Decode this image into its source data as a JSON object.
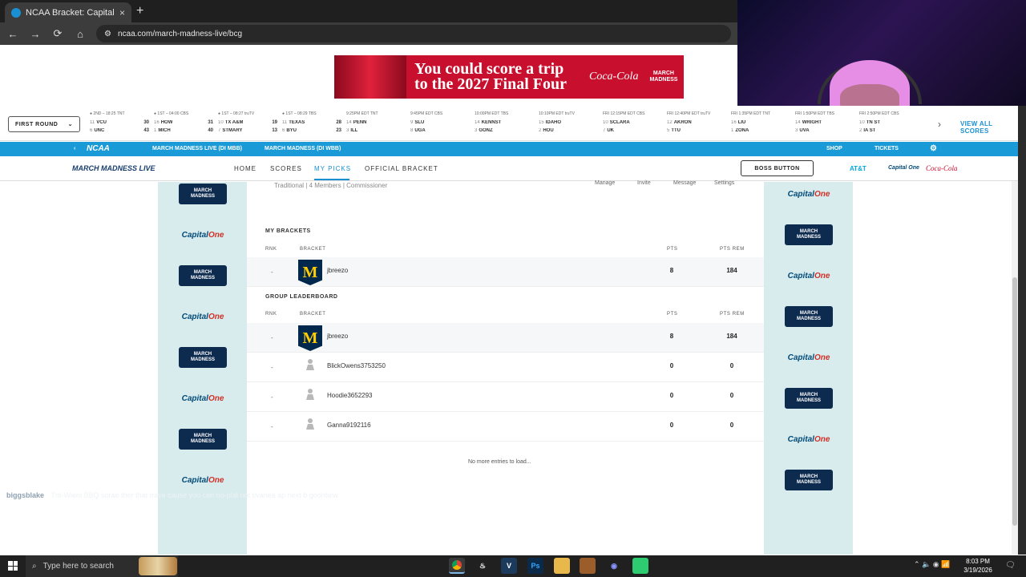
{
  "browser": {
    "tab_title": "NCAA Bracket: Capital One March Madness",
    "new_tab": "+",
    "close": "×",
    "url": "ncaa.com/march-madness-live/bcg",
    "back": "←",
    "forward": "→",
    "reload": "⟳",
    "home": "⌂",
    "site_info": "⚙"
  },
  "ad": {
    "headline_1": "You could score a trip",
    "headline_2": "to the 2027 Final Four",
    "brand": "Coca-Cola",
    "partner_1": "MARCH",
    "partner_2": "MADNESS"
  },
  "ticker": {
    "round_label": "FIRST ROUND",
    "round_chevron": "⌄",
    "games": [
      {
        "status": "● 2ND – 18:25   TNT",
        "t1_seed": "11",
        "t1": "VCU",
        "t1_score": "30",
        "t2_seed": "6",
        "t2": "UNC",
        "t2_score": "43"
      },
      {
        "status": "● 1ST – 04:00   CBS",
        "t1_seed": "16",
        "t1": "HOW",
        "t1_score": "31",
        "t2_seed": "1",
        "t2": "MICH",
        "t2_score": "40"
      },
      {
        "status": "● 1ST – 08:27   truTV",
        "t1_seed": "10",
        "t1": "TX A&M",
        "t1_score": "19",
        "t2_seed": "7",
        "t2": "STMARY",
        "t2_score": "13"
      },
      {
        "status": "● 1ST – 08:29   TBS",
        "t1_seed": "11",
        "t1": "TEXAS",
        "t1_score": "28",
        "t2_seed": "6",
        "t2": "BYU",
        "t2_score": "23"
      },
      {
        "status": "9:25PM EDT   TNT",
        "t1_seed": "14",
        "t1": "PENN",
        "t1_score": "",
        "t2_seed": "3",
        "t2": "ILL",
        "t2_score": ""
      },
      {
        "status": "9:45PM EDT   CBS",
        "t1_seed": "9",
        "t1": "SLU",
        "t1_score": "",
        "t2_seed": "8",
        "t2": "UGA",
        "t2_score": ""
      },
      {
        "status": "10:00PM EDT   TBS",
        "t1_seed": "14",
        "t1": "KENNST",
        "t1_score": "",
        "t2_seed": "3",
        "t2": "GONZ",
        "t2_score": ""
      },
      {
        "status": "10:10PM EDT   truTV",
        "t1_seed": "15",
        "t1": "IDAHO",
        "t1_score": "",
        "t2_seed": "2",
        "t2": "HOU",
        "t2_score": ""
      },
      {
        "status": "FRI 12:15PM EDT   CBS",
        "t1_seed": "10",
        "t1": "SCLARA",
        "t1_score": "",
        "t2_seed": "7",
        "t2": "UK",
        "t2_score": ""
      },
      {
        "status": "FRI 12:40PM EDT   truTV",
        "t1_seed": "12",
        "t1": "AKRON",
        "t1_score": "",
        "t2_seed": "5",
        "t2": "TTU",
        "t2_score": ""
      },
      {
        "status": "FRI 1:35PM EDT   TNT",
        "t1_seed": "16",
        "t1": "LIU",
        "t1_score": "",
        "t2_seed": "1",
        "t2": "ZONA",
        "t2_score": ""
      },
      {
        "status": "FRI 1:50PM EDT   TBS",
        "t1_seed": "14",
        "t1": "WRIGHT",
        "t1_score": "",
        "t2_seed": "3",
        "t2": "UVA",
        "t2_score": ""
      },
      {
        "status": "FRI 2:50PM EDT   CBS",
        "t1_seed": "10",
        "t1": "TN ST",
        "t1_score": "",
        "t2_seed": "2",
        "t2": "IA ST",
        "t2_score": ""
      }
    ],
    "next": "›",
    "view_all": "VIEW ALL SCORES"
  },
  "bluenav": {
    "prev": "‹",
    "ncaa": "NCAA",
    "mml_mbb": "MARCH MADNESS LIVE (DI MBB)",
    "mml_wbb": "MARCH MADNESS (DI WBB)",
    "shop": "SHOP",
    "tickets": "TICKETS",
    "settings": "⚙"
  },
  "subnav": {
    "logo": "MARCH MADNESS LIVE",
    "home": "HOME",
    "scores": "SCORES",
    "my_picks": "MY PICKS",
    "official_bracket": "OFFICIAL BRACKET",
    "boss_button": "BOSS BUTTON",
    "sponsor_att": "AT&T",
    "sponsor_c1": "Capital One",
    "sponsor_coke": "Coca-Cola"
  },
  "rails": {
    "mm_line1": "MARCH",
    "mm_line2": "MADNESS",
    "c1_word": "Capital",
    "c1_word2": "One"
  },
  "group": {
    "meta": "Traditional | 4 Members | Commissioner",
    "manage": "Manage",
    "invite": "Invite",
    "message": "Message",
    "settings": "Settings"
  },
  "my_brackets": {
    "title": "MY BRACKETS",
    "col_rnk": "RNK",
    "col_bracket": "BRACKET",
    "col_pts": "PTS",
    "col_pts_rem": "PTS REM",
    "entries": [
      {
        "rnk": "-",
        "name": "jbreezo",
        "pts": "8",
        "rem": "184",
        "badge": "M"
      }
    ]
  },
  "leaderboard": {
    "title": "GROUP LEADERBOARD",
    "col_rnk": "RNK",
    "col_bracket": "BRACKET",
    "col_pts": "PTS",
    "col_pts_rem": "PTS REM",
    "entries": [
      {
        "rnk": "-",
        "name": "jbreezo",
        "pts": "8",
        "rem": "184",
        "badge": "M"
      },
      {
        "rnk": "-",
        "name": "BlickOwens3753250",
        "pts": "0",
        "rem": "0"
      },
      {
        "rnk": "-",
        "name": "Hoodie3652293",
        "pts": "0",
        "rem": "0"
      },
      {
        "rnk": "-",
        "name": "Ganna9192116",
        "pts": "0",
        "rem": "0"
      }
    ],
    "no_more": "No more entries to load..."
  },
  "chat": {
    "user": "biggsblake",
    "message": "Tnt-Wieni BBQ sorae ther that trave cause you can no-plat not tivanea ap next b goohtiew"
  },
  "taskbar": {
    "search_placeholder": "Type here to search",
    "tray_icons": "⌃  🔈  ◉  📶",
    "time": "8:03 PM",
    "date": "3/19/2026",
    "notifications": "🗨"
  },
  "colors": {
    "accent_blue": "#1a9ad6",
    "rail_bg": "#d8ecee",
    "michigan_navy": "#00274c",
    "michigan_maize": "#ffcb05",
    "coke_red": "#c8102e"
  }
}
